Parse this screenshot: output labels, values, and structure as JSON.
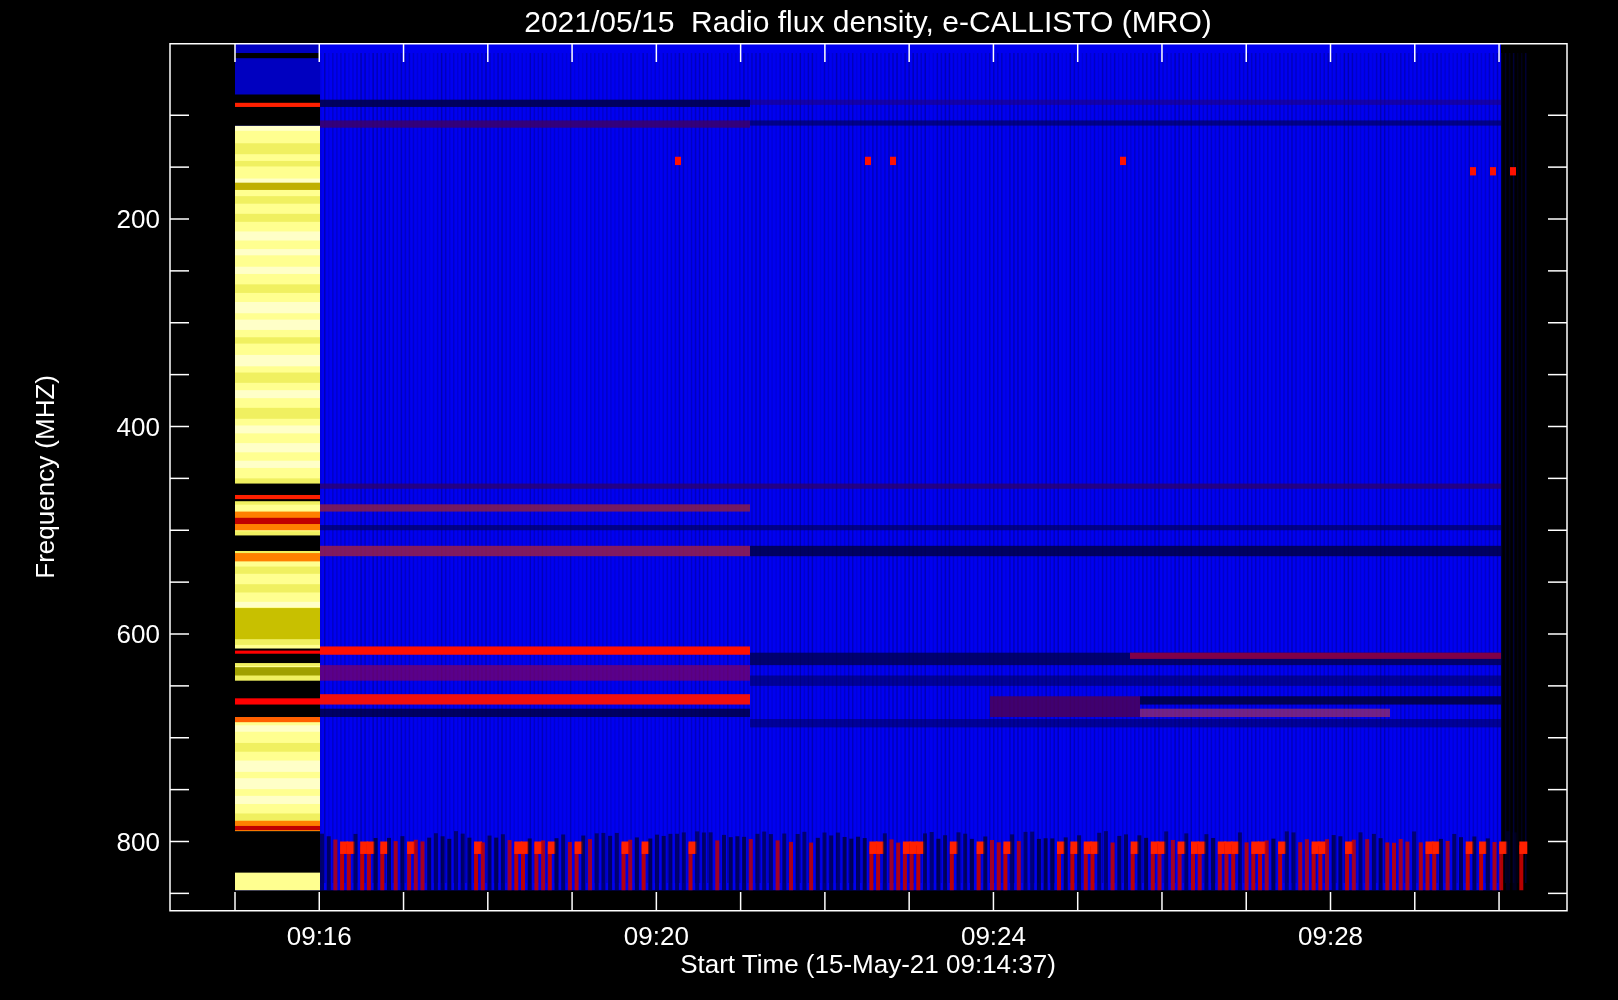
{
  "title": "2021/05/15  Radio flux density, e-CALLISTO (MRO)",
  "y_axis": {
    "label": "Frequency (MHZ)",
    "ticks": [
      "200",
      "400",
      "600",
      "800"
    ]
  },
  "x_axis": {
    "label": "Start Time (15-May-21 09:14:37)",
    "ticks": [
      "09:16",
      "09:20",
      "09:24",
      "09:28"
    ]
  }
}
